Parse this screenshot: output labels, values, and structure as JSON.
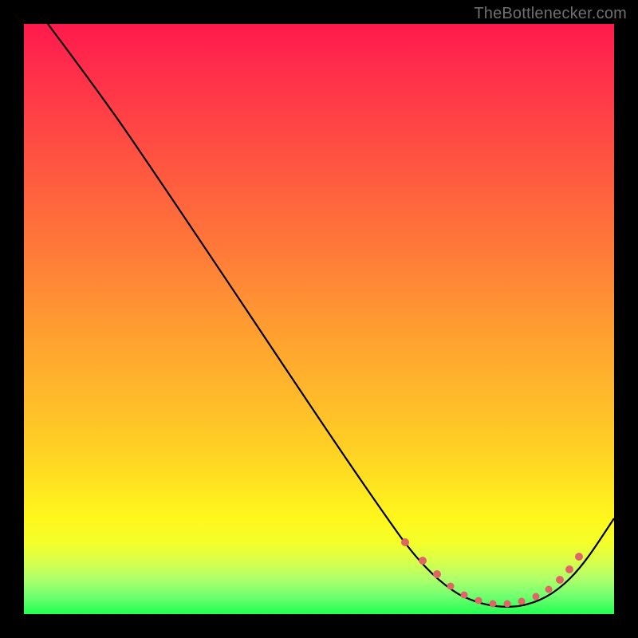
{
  "watermark": "TheBottlenecker.com",
  "chart_data": {
    "type": "line",
    "title": "",
    "xlabel": "",
    "ylabel": "",
    "xlim": [
      0,
      100
    ],
    "ylim": [
      0,
      100
    ],
    "grid": false,
    "legend": false,
    "series": [
      {
        "name": "bottleneck-curve",
        "x": [
          0,
          5,
          10,
          15,
          20,
          25,
          30,
          35,
          40,
          45,
          50,
          55,
          60,
          65,
          67,
          70,
          73,
          76,
          79,
          82,
          85,
          88,
          91,
          94,
          97,
          100
        ],
        "y": [
          100,
          97,
          92,
          86,
          79,
          72,
          65,
          58,
          51,
          44,
          37,
          30,
          23,
          16,
          13,
          9,
          6,
          4,
          2.5,
          2,
          2,
          2.5,
          4,
          7,
          11,
          16
        ],
        "color": "#000000"
      }
    ],
    "markers": [
      {
        "name": "flat-zone-dots",
        "color": "#e06666",
        "x": [
          67,
          70,
          73,
          76,
          79,
          82,
          85,
          88,
          91
        ],
        "y": [
          10,
          8.5,
          7,
          6,
          5,
          5,
          5.5,
          6.5,
          8
        ]
      }
    ],
    "background_gradient": {
      "orientation": "vertical",
      "stops": [
        {
          "pos": 0.0,
          "color": "#ff1a4d"
        },
        {
          "pos": 0.5,
          "color": "#ffa22e"
        },
        {
          "pos": 0.85,
          "color": "#fff81c"
        },
        {
          "pos": 1.0,
          "color": "#20ff50"
        }
      ]
    }
  }
}
